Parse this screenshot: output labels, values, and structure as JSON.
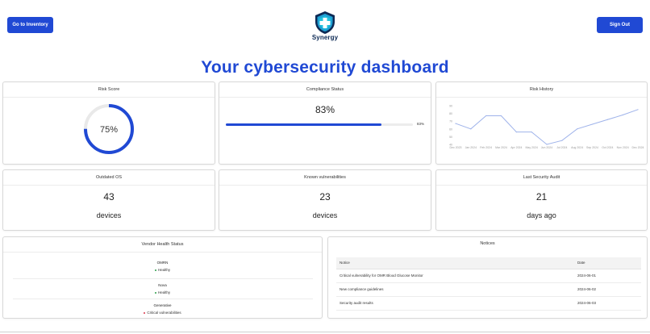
{
  "header": {
    "inventory_button": "Go to Inventory",
    "signout_button": "Sign Out",
    "logo_text": "Synergy",
    "page_title": "Your cybersecurity dashboard"
  },
  "colors": {
    "accent": "#2049d4",
    "healthy": "#2e9d4a",
    "critical": "#d9364a",
    "chart_line": "#9fb3ea"
  },
  "risk_score": {
    "title": "Risk Score",
    "value_label": "75%",
    "value": 75
  },
  "compliance": {
    "title": "Compliance Status",
    "value_label": "83%",
    "value": 83,
    "bar_label": "83%"
  },
  "risk_history": {
    "title": "Risk History"
  },
  "chart_data": {
    "type": "line",
    "x": [
      "Dec 2023",
      "Jan 2024",
      "Feb 2024",
      "Mar 2024",
      "Apr 2024",
      "May 2024",
      "Jun 2024",
      "Jul 2024",
      "Aug 2024",
      "Sep 2024",
      "Oct 2024",
      "Nov 2024",
      "Dec 2024"
    ],
    "values": [
      67,
      60,
      77,
      77,
      56,
      56,
      40,
      45,
      60,
      66,
      72,
      78,
      85
    ],
    "ylim": [
      40,
      90
    ],
    "yticks": [
      40,
      50,
      60,
      70,
      80,
      90
    ],
    "ytick_labels": [
      "40",
      "50",
      "60",
      "70",
      "80",
      "90"
    ],
    "grid": false
  },
  "outdated_os": {
    "title": "Outdated OS",
    "value": "43",
    "unit": "devices"
  },
  "known_vulns": {
    "title": "Known vulnerabilities",
    "value": "23",
    "unit": "devices"
  },
  "last_audit": {
    "title": "Last Security Audit",
    "value": "21",
    "unit": "days ago"
  },
  "vendor_health": {
    "title": "Vendor Health Status",
    "vendors": [
      {
        "name": "OMRN",
        "status": "Healthy"
      },
      {
        "name": "Nova",
        "status": "Healthy"
      },
      {
        "name": "Generative",
        "status": "Critical vulnerabilities"
      }
    ]
  },
  "notices": {
    "title": "Notices",
    "columns": [
      "Notice",
      "Date"
    ],
    "rows": [
      {
        "notice": "Critical vulnerability for OMR Blood Glucose Monitor",
        "date": "2024-06-01"
      },
      {
        "notice": "New compliance guidelines",
        "date": "2024-06-02"
      },
      {
        "notice": "Security audit results",
        "date": "2024-06-03"
      }
    ]
  }
}
